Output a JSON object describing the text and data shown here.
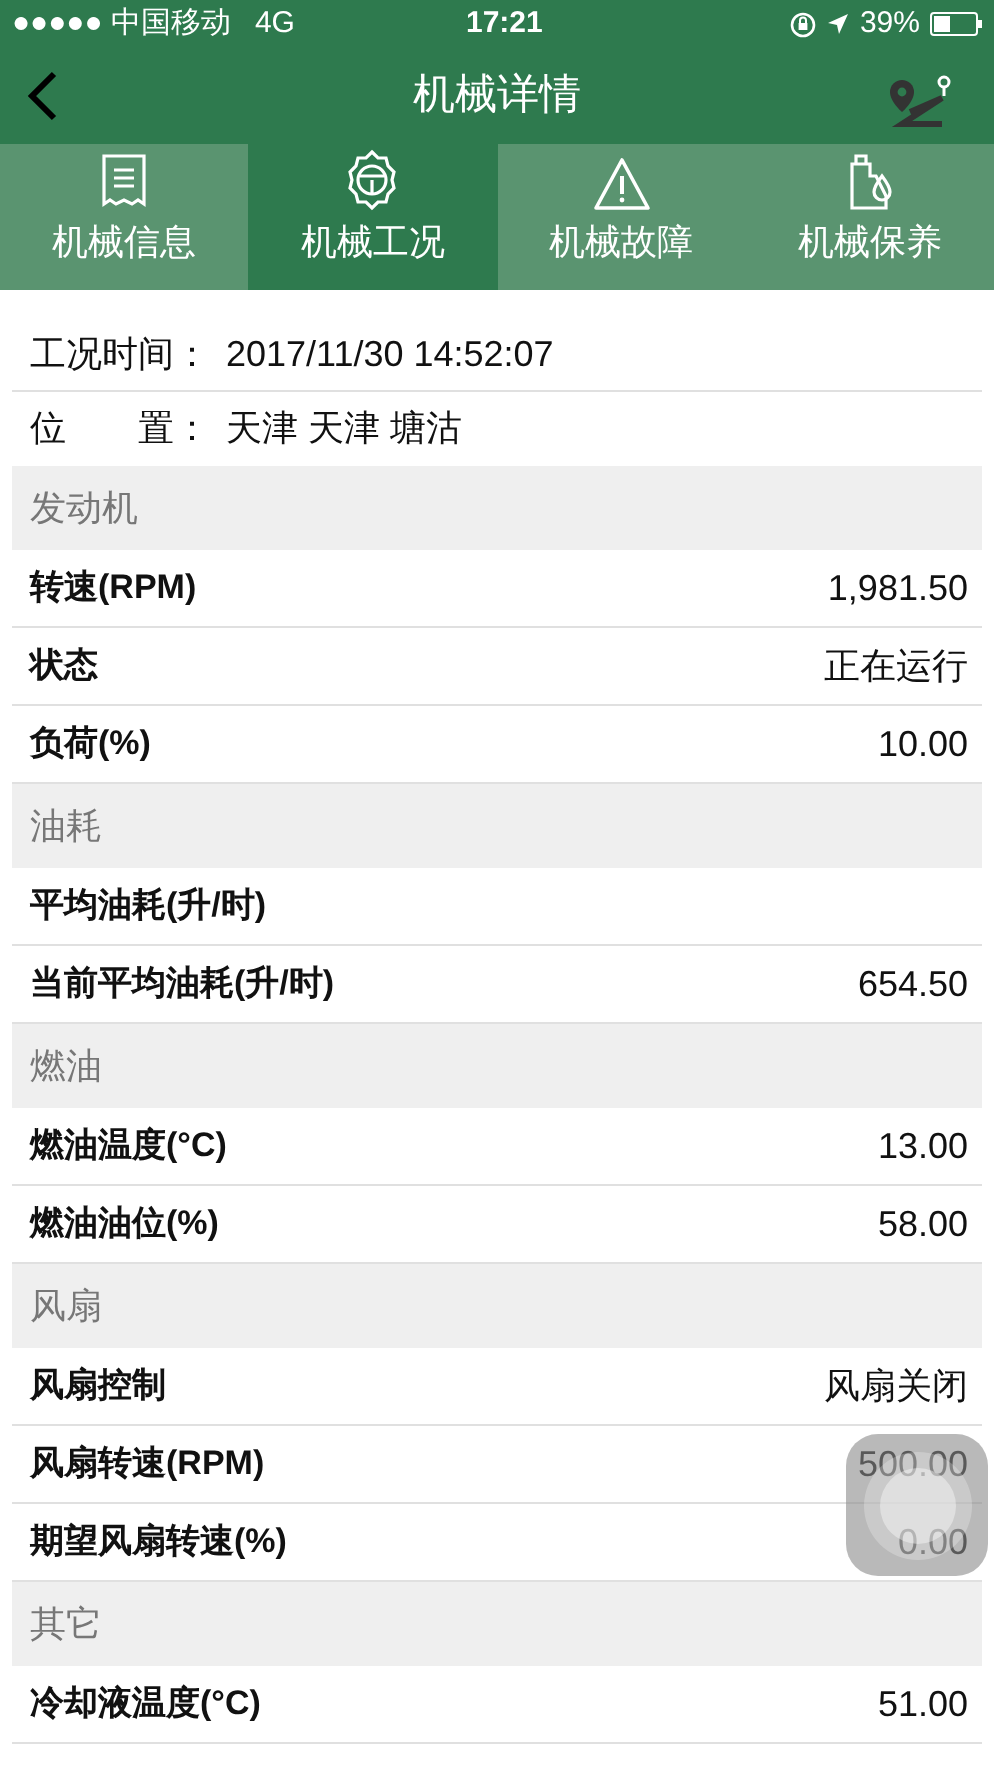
{
  "status_bar": {
    "carrier": "●●●●● 中国移动",
    "network": "4G",
    "time": "17:21",
    "battery": "39%"
  },
  "nav_bar": {
    "title": "机械详情"
  },
  "tabs": [
    {
      "label": "机械信息",
      "kind": "document",
      "selected": false
    },
    {
      "label": "机械工况",
      "kind": "gear",
      "selected": true
    },
    {
      "label": "机械故障",
      "kind": "warning",
      "selected": false
    },
    {
      "label": "机械保养",
      "kind": "oil",
      "selected": false
    }
  ],
  "info": [
    {
      "label": "工况时间：",
      "value": "2017/11/30 14:52:07"
    },
    {
      "label": "位　　置：",
      "value": "天津 天津 塘沽"
    }
  ],
  "sections": [
    {
      "title": "发动机",
      "rows": [
        {
          "label": "转速(RPM)",
          "value": "1,981.50"
        },
        {
          "label": "状态",
          "value": "正在运行"
        },
        {
          "label": "负荷(%)",
          "value": "10.00"
        }
      ]
    },
    {
      "title": "油耗",
      "rows": [
        {
          "label": "平均油耗(升/时)"
        },
        {
          "label": "当前平均油耗(升/时)",
          "value": "654.50"
        }
      ]
    },
    {
      "title": "燃油",
      "rows": [
        {
          "label": "燃油温度(°C)",
          "value": "13.00"
        },
        {
          "label": "燃油油位(%)",
          "value": "58.00"
        }
      ]
    },
    {
      "title": "风扇",
      "rows": [
        {
          "label": "风扇控制",
          "value": "风扇关闭"
        },
        {
          "label": "风扇转速(RPM)",
          "value": "500.00"
        },
        {
          "label": "期望风扇转速(%)",
          "value": "0.00"
        }
      ]
    },
    {
      "title": "其它",
      "rows": [
        {
          "label": "冷却液温度(°C)",
          "value": "51.00"
        }
      ]
    }
  ]
}
